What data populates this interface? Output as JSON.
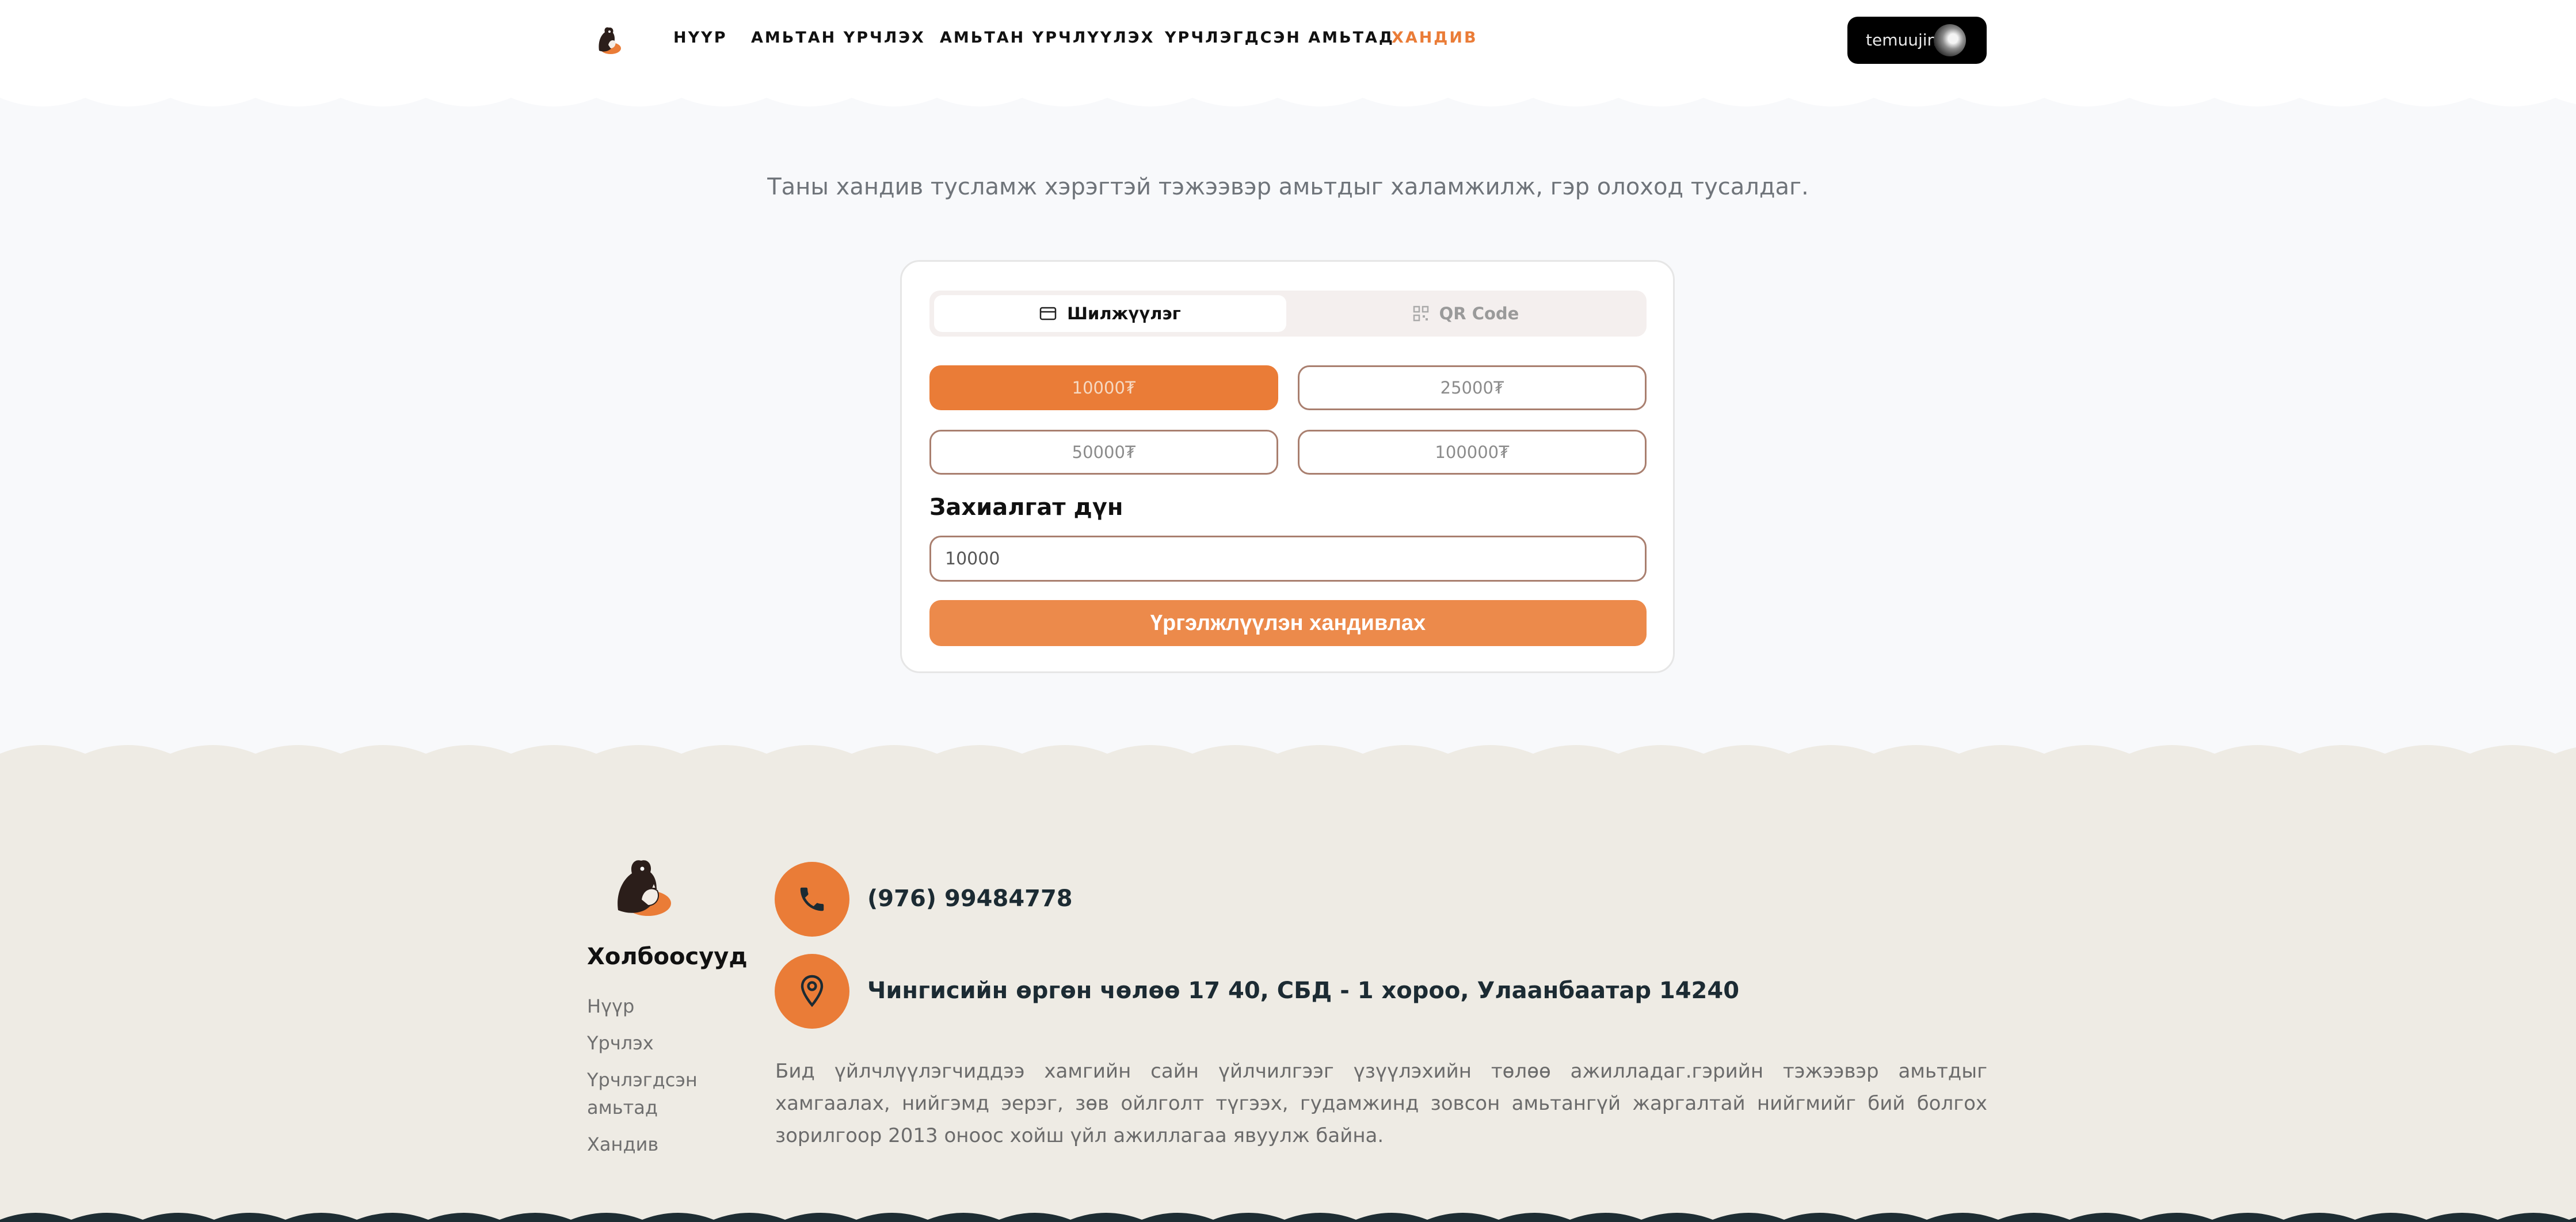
{
  "nav": {
    "items": [
      {
        "label": "НҮҮР"
      },
      {
        "label": "АМЬТАН ҮРЧЛЭХ"
      },
      {
        "label": "АМЬТАН ҮРЧЛҮҮЛЭХ"
      },
      {
        "label": "ҮРЧЛЭГДСЭН АМЬТАД"
      },
      {
        "label": "ХАНДИВ"
      }
    ],
    "active": "ХАНДИВ",
    "user": "temuujin"
  },
  "donation": {
    "tagline": "Таны хандив тусламж хэрэгтэй тэжээвэр амьтдыг халамжилж, гэр олоход тусалдаг.",
    "tabs": [
      {
        "label": "Шилжүүлэг",
        "icon": "card-icon"
      },
      {
        "label": "QR Code",
        "icon": "qr-icon"
      }
    ],
    "amounts": [
      "10000₮",
      "25000₮",
      "50000₮",
      "100000₮"
    ],
    "selected_amount": "10000₮",
    "custom_label": "Захиалгат дүн",
    "custom_value": "10000",
    "submit_label": "Үргэлжлүүлэн хандивлах"
  },
  "footer": {
    "title": "Холбоосууд",
    "links": [
      "Нүүр",
      "Үрчлэх",
      "Үрчлэгдсэн амьтад",
      "Хандив"
    ],
    "phone": "(976) 99484778",
    "address": "Чингисийн өргөн чөлөө 17 40, СБД - 1 хороо, Улаанбаатар 14240",
    "about": "Бид үйлчлүүлэгчиддээ хамгийн сайн үйлчилгээг үзүүлэхийн төлөө ажилладаг.гэрийн тэжээвэр амьтдыг хамгаалах, нийгэмд эерэг, зөв ойлголт түгээх, гудамжинд зовсон амьтангүй жаргалтай нийгмийг бий болгох зорилгоор 2013 оноос хойш үйл ажиллагаа явуулж байна."
  },
  "colors": {
    "accent": "#ea7c37",
    "footer_bg": "#eeebe4",
    "page_bg": "#f8f9fb",
    "border": "#a97f6f"
  }
}
